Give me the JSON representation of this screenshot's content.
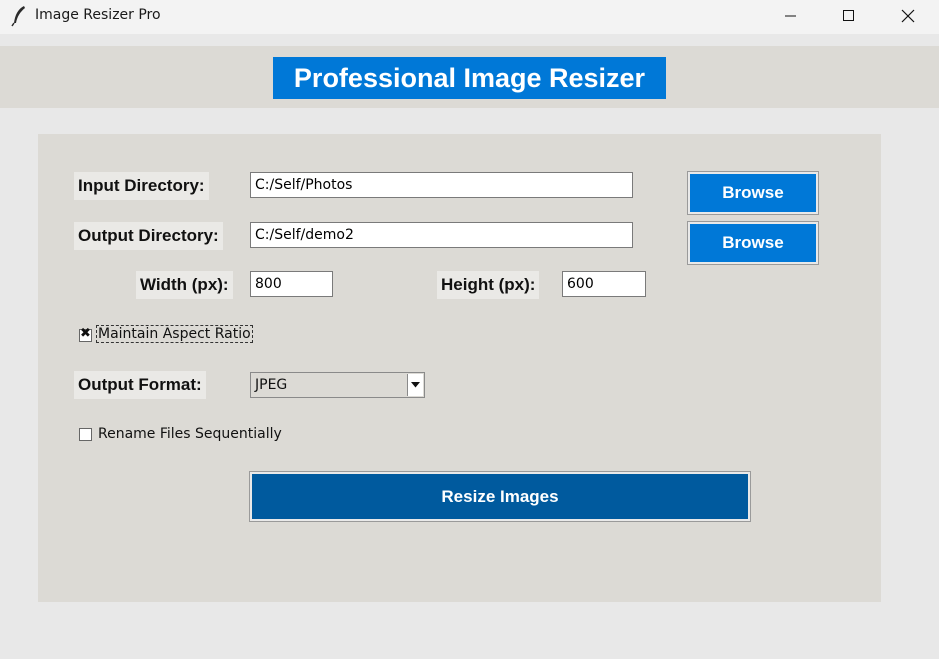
{
  "window": {
    "title": "Image Resizer Pro",
    "controls": [
      "minimize",
      "maximize",
      "close"
    ]
  },
  "header": {
    "title": "Professional Image Resizer"
  },
  "form": {
    "input_directory": {
      "label": "Input Directory:",
      "value": "C:/Self/Photos",
      "button": "Browse"
    },
    "output_directory": {
      "label": "Output Directory:",
      "value": "C:/Self/demo2",
      "button": "Browse"
    },
    "width": {
      "label": "Width (px):",
      "value": "800"
    },
    "height": {
      "label": "Height (px):",
      "value": "600"
    },
    "maintain_aspect": {
      "label": "Maintain Aspect Ratio",
      "checked": true,
      "mark": "✖"
    },
    "output_format": {
      "label": "Output Format:",
      "selected": "JPEG"
    },
    "rename_sequential": {
      "label": "Rename Files Sequentially",
      "checked": false
    },
    "submit": {
      "label": "Resize Images"
    }
  },
  "colors": {
    "accent": "#0078d7",
    "resize_button": "#005a9e",
    "panel": "#dcdad5",
    "background": "#e8e8e8"
  },
  "icons": {
    "app": "feather-icon",
    "minimize": "minimize-icon",
    "maximize": "maximize-icon",
    "close": "close-icon",
    "dropdown": "dropdown-arrow-icon"
  }
}
